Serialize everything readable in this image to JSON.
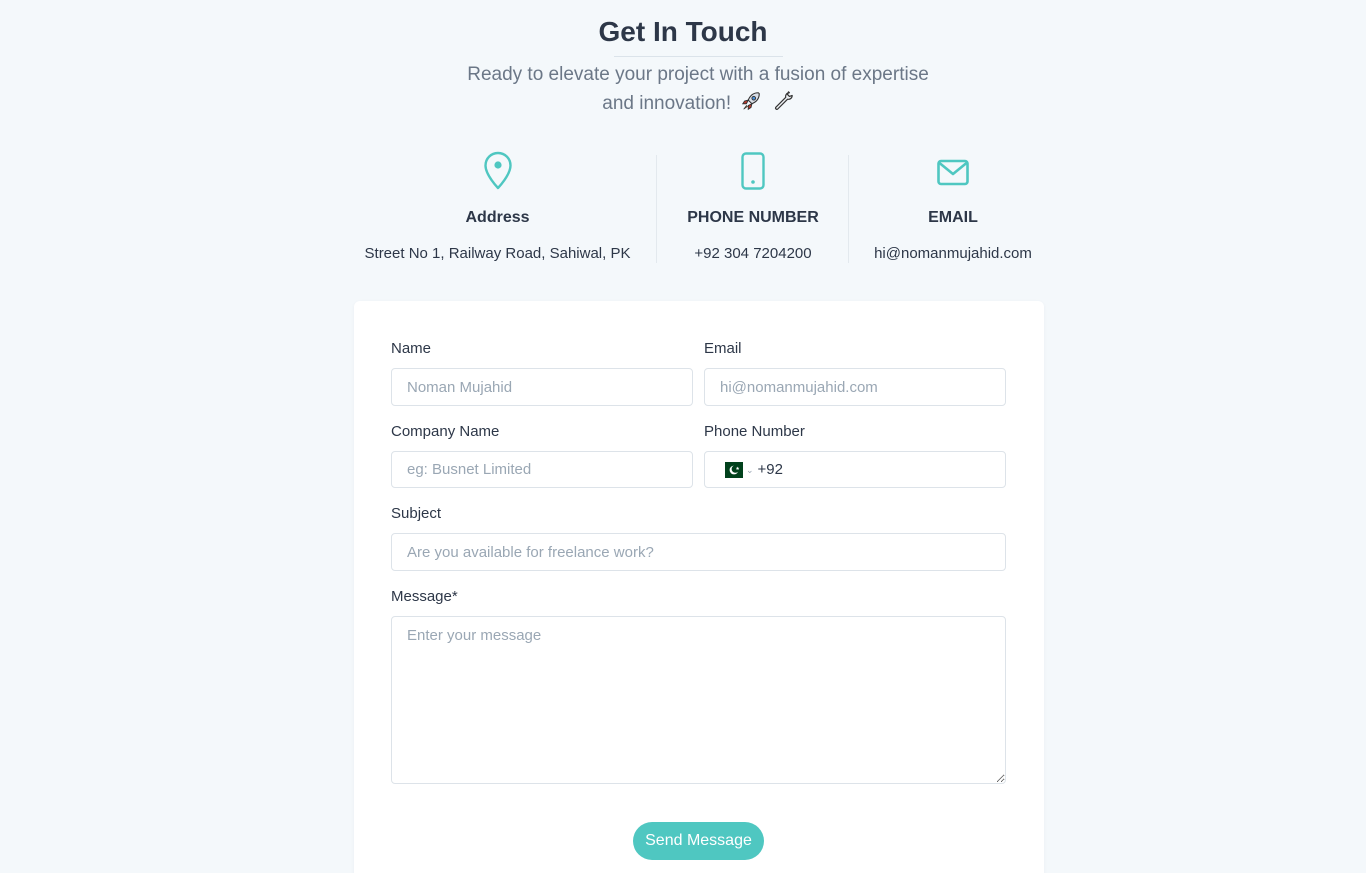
{
  "header": {
    "title": "Get In Touch",
    "subtitle_line1": "Ready to elevate your project with a fusion of expertise",
    "subtitle_line2": "and innovation!"
  },
  "contact_info": {
    "address": {
      "label": "Address",
      "value": "Street No 1, Railway Road, Sahiwal, PK",
      "icon": "map-pin-icon"
    },
    "phone": {
      "label": "PHONE NUMBER",
      "value": "+92 304 7204200",
      "icon": "smartphone-icon"
    },
    "email": {
      "label": "EMAIL",
      "value": "hi@nomanmujahid.com",
      "icon": "mail-icon"
    }
  },
  "form": {
    "name": {
      "label": "Name",
      "placeholder": "Noman Mujahid",
      "value": ""
    },
    "email": {
      "label": "Email",
      "placeholder": "hi@nomanmujahid.com",
      "value": ""
    },
    "company": {
      "label": "Company Name",
      "placeholder": "eg: Busnet Limited",
      "value": ""
    },
    "phone": {
      "label": "Phone Number",
      "country": "PK",
      "value": "+92"
    },
    "subject": {
      "label": "Subject",
      "placeholder": "Are you available for freelance work?",
      "value": ""
    },
    "message": {
      "label": "Message*",
      "placeholder": "Enter your message",
      "value": ""
    },
    "submit_label": "Send Message"
  },
  "colors": {
    "accent": "#4fc7c1",
    "background": "#f4f8fb",
    "text": "#2d3748",
    "muted": "#6b7787"
  }
}
